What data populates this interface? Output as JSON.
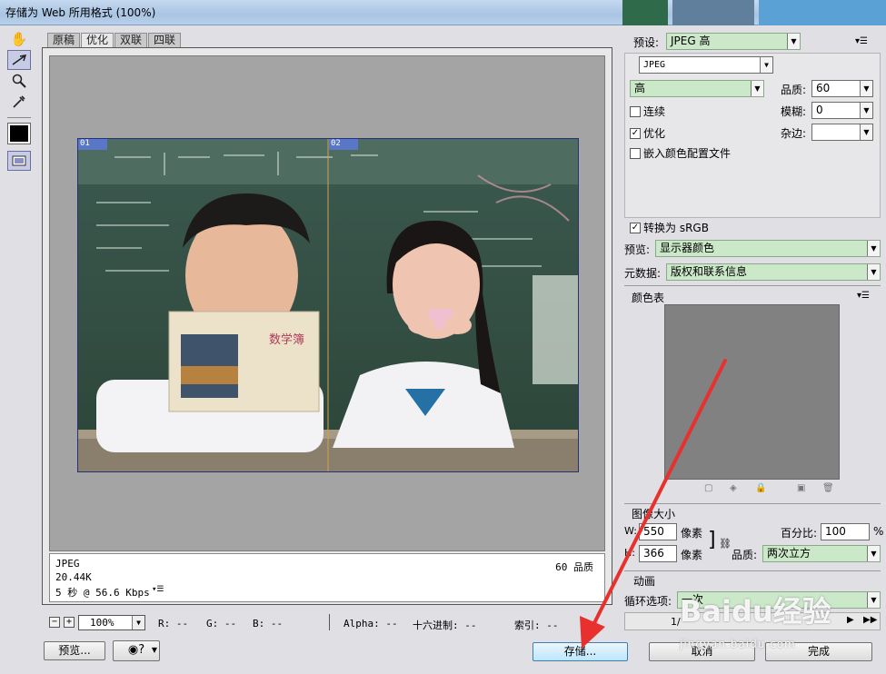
{
  "window": {
    "title": "存储为 Web 所用格式 (100%)"
  },
  "tabs": [
    {
      "label": "原稿",
      "active": false
    },
    {
      "label": "优化",
      "active": true
    },
    {
      "label": "双联",
      "active": false
    },
    {
      "label": "四联",
      "active": false
    }
  ],
  "tools": [
    "hand-tool",
    "slice-select-tool",
    "zoom-tool",
    "eyedropper-tool"
  ],
  "preview": {
    "slice1": "01",
    "slice2": "02",
    "info": {
      "format": "JPEG",
      "size": "20.44K",
      "time": "5 秒 @ 56.6 Kbps",
      "quality": "60 品质"
    }
  },
  "status": {
    "zoom": "100%",
    "r": "R: --",
    "g": "G: --",
    "b": "B: --",
    "alpha": "Alpha: --",
    "hex": "十六进制: --",
    "index": "索引: --"
  },
  "buttons": {
    "preview": "预览...",
    "save": "存储...",
    "cancel": "取消",
    "done": "完成"
  },
  "settings": {
    "preset_label": "预设:",
    "preset_value": "JPEG 高",
    "format_value": "JPEG",
    "compression_value": "高",
    "quality_label": "品质:",
    "quality_value": "60",
    "progressive_label": "连续",
    "blur_label": "模糊:",
    "blur_value": "0",
    "optimized_label": "优化",
    "matte_label": "杂边:",
    "icc_label": "嵌入颜色配置文件",
    "srgb_label": "转换为 sRGB",
    "preview_label": "预览:",
    "preview_value": "显示器颜色",
    "metadata_label": "元数据:",
    "metadata_value": "版权和联系信息"
  },
  "color_table": {
    "label": "颜色表"
  },
  "image_size": {
    "label": "图像大小",
    "w_label": "W:",
    "w_value": "550",
    "h_label": "H:",
    "h_value": "366",
    "unit": "像素",
    "percent_label": "百分比:",
    "percent_value": "100",
    "percent_unit": "%",
    "quality_label": "品质:",
    "quality_value": "两次立方"
  },
  "animation": {
    "label": "动画",
    "loop_label": "循环选项:",
    "loop_value": "一次",
    "frame_counter": "1/"
  },
  "watermark": {
    "brand": "Baidu经验",
    "url": "jingyan.baidu.com"
  },
  "colors": {
    "field_green": "#cbe8c8",
    "annotation_red": "#e8312f",
    "slice_border": "#27307a"
  }
}
